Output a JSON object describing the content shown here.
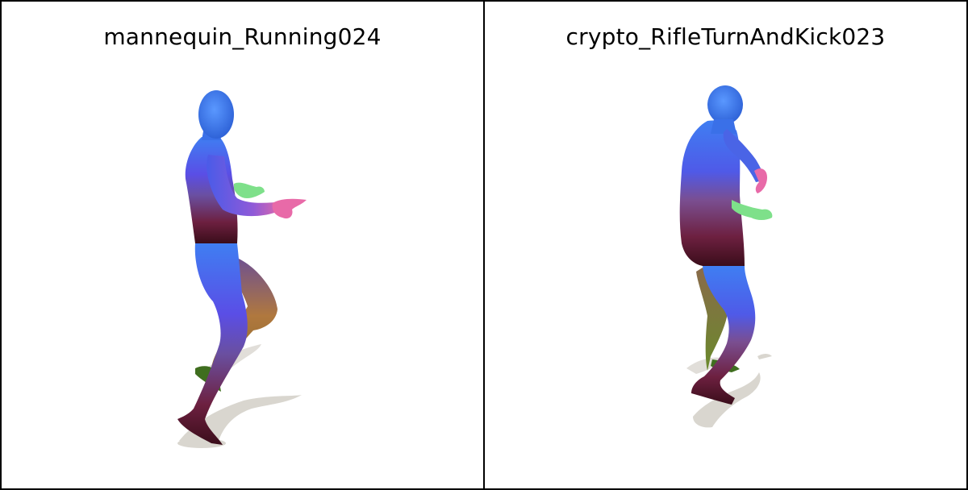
{
  "panels": [
    {
      "title": "mannequin_Running024"
    },
    {
      "title": "crypto_RifleTurnAndKick023"
    }
  ],
  "colors": {
    "border": "#000000",
    "background": "#ffffff",
    "shadow": "#d9d6cf",
    "head": "#3f7cf0",
    "torso": "#4a62e8",
    "legs_dark": "#5a1430",
    "hand_pink": "#e86aa8",
    "hand_green": "#7ee08a",
    "leg_olive": "#9a8a3a",
    "foot_green": "#3f6e1f"
  }
}
